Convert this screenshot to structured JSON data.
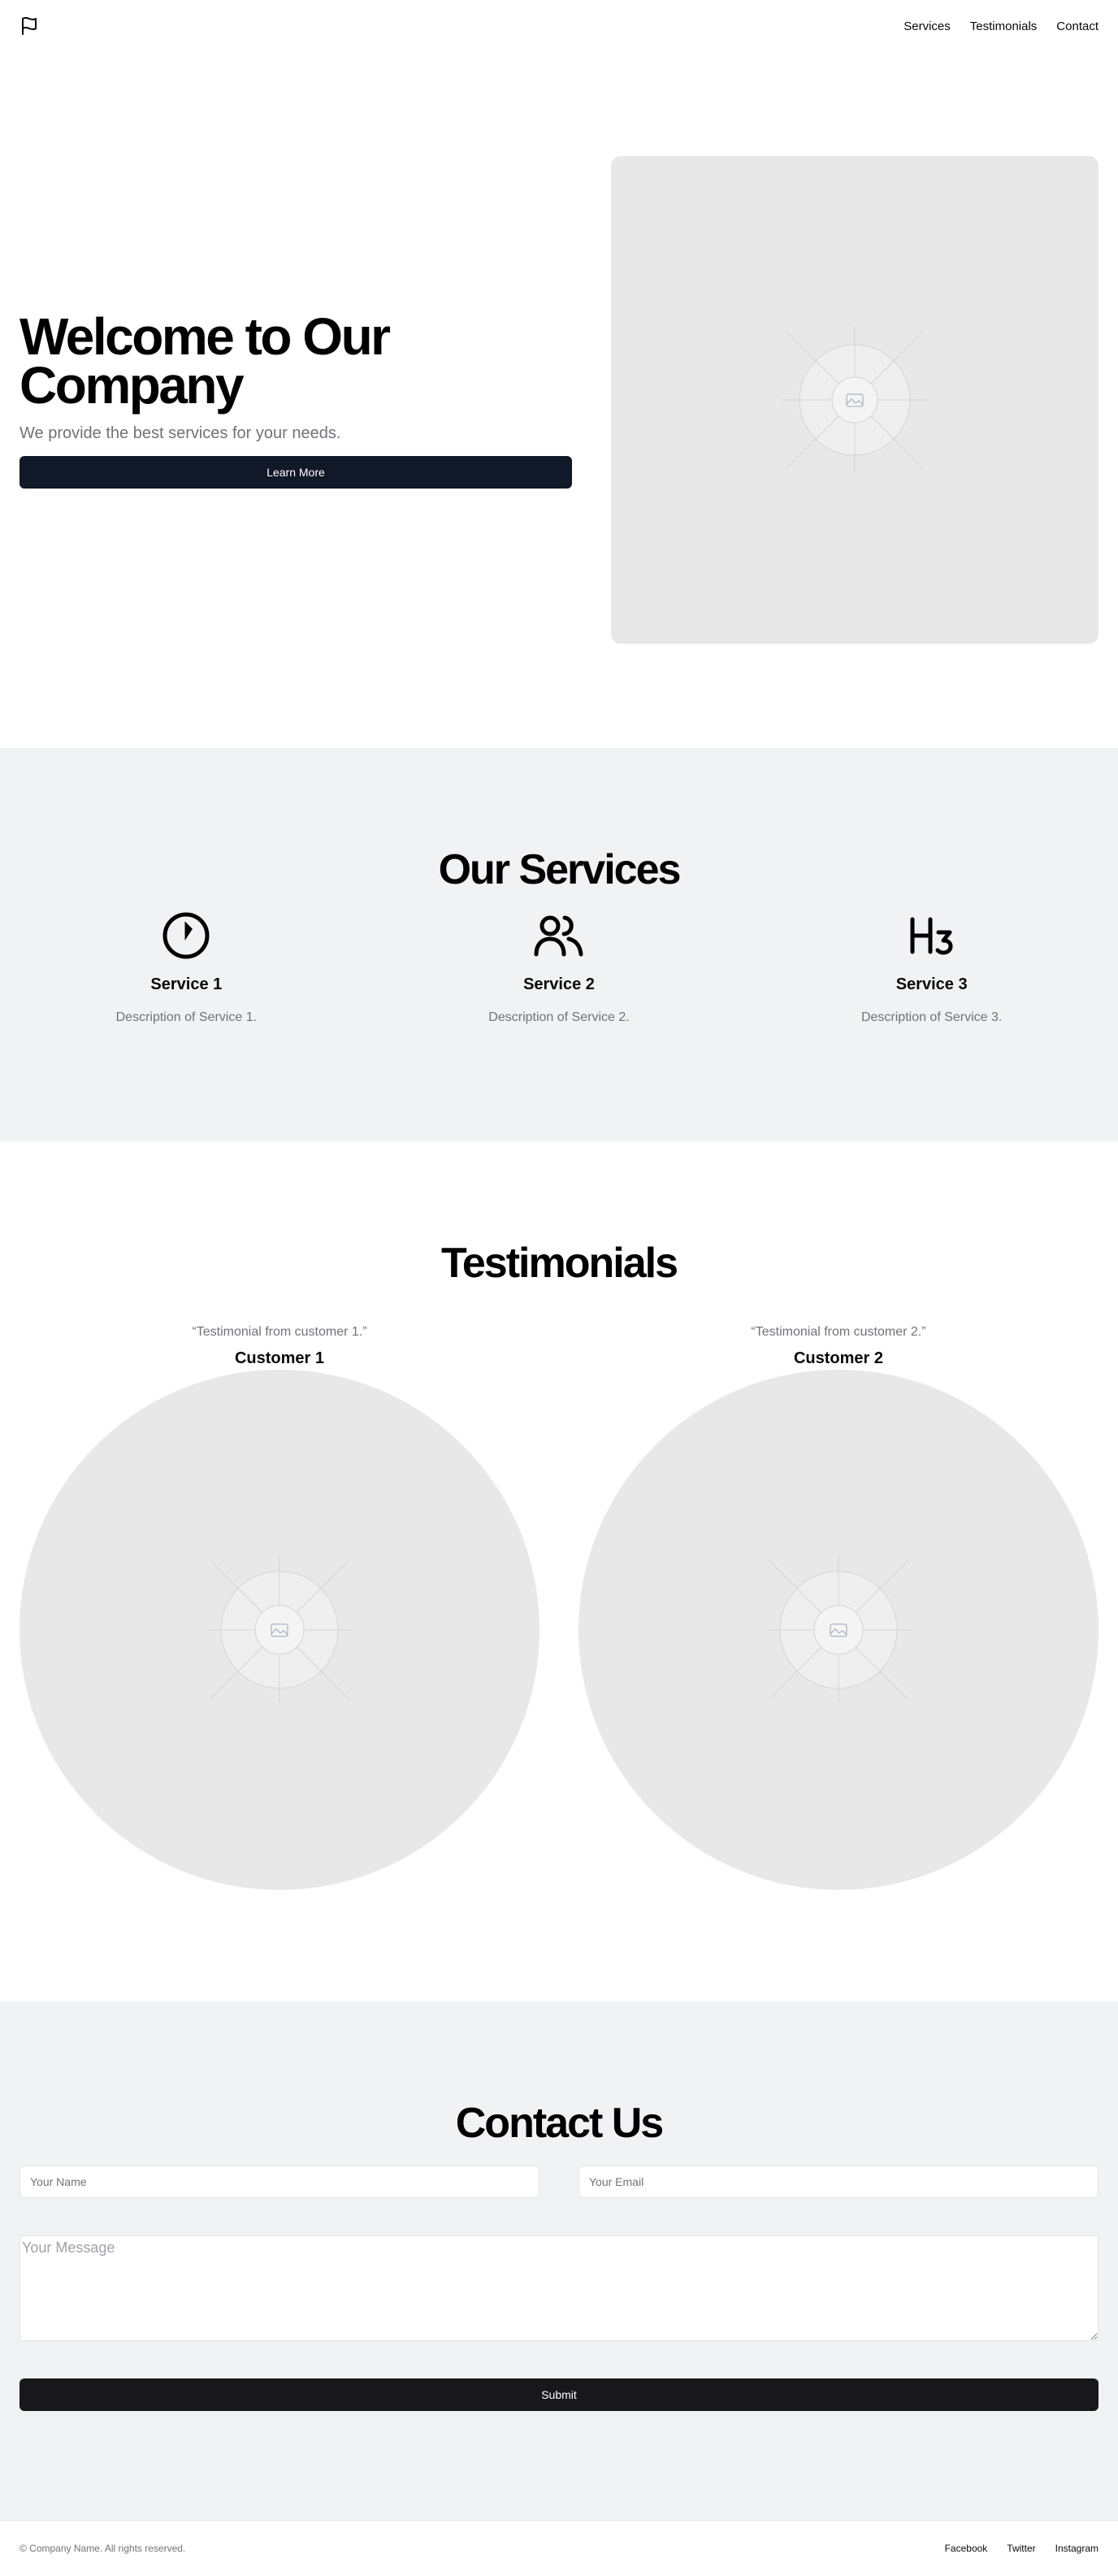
{
  "header": {
    "nav": [
      {
        "label": "Services"
      },
      {
        "label": "Testimonials"
      },
      {
        "label": "Contact"
      }
    ]
  },
  "hero": {
    "title": "Welcome to Our Company",
    "subtitle": "We provide the best services for your needs.",
    "cta_label": "Learn More",
    "image_icon": "image-placeholder-icon"
  },
  "services": {
    "title": "Our Services",
    "items": [
      {
        "icon": "timer-icon",
        "name": "Service 1",
        "description": "Description of Service 1."
      },
      {
        "icon": "users-icon",
        "name": "Service 2",
        "description": "Description of Service 2."
      },
      {
        "icon": "heading-3-icon",
        "name": "Service 3",
        "description": "Description of Service 3."
      }
    ]
  },
  "testimonials": {
    "title": "Testimonials",
    "items": [
      {
        "quote": "“Testimonial from customer 1.”",
        "name": "Customer 1"
      },
      {
        "quote": "“Testimonial from customer 2.”",
        "name": "Customer 2"
      }
    ]
  },
  "contact": {
    "title": "Contact Us",
    "name_placeholder": "Your Name",
    "email_placeholder": "Your Email",
    "message_placeholder": "Your Message",
    "submit_label": "Submit"
  },
  "footer": {
    "copyright": "© Company Name. All rights reserved.",
    "links": [
      {
        "label": "Facebook"
      },
      {
        "label": "Twitter"
      },
      {
        "label": "Instagram"
      }
    ]
  },
  "colors": {
    "primary_button": "#111827",
    "submit_button": "#18181b",
    "section_gray": "#f1f2f4",
    "placeholder_gray": "#e8e8e8",
    "muted_text": "#71717a"
  }
}
